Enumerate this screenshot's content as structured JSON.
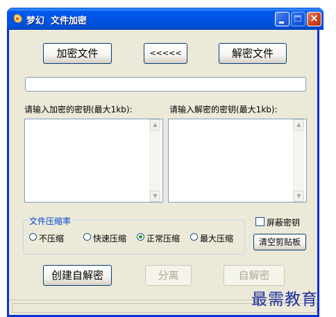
{
  "window": {
    "title": "梦幻  文件加密"
  },
  "toolbar": {
    "encrypt_label": "加密文件",
    "swap_label": "<<<<<",
    "decrypt_label": "解密文件"
  },
  "keys": {
    "encrypt_label": "请输入加密的密钥(最大1kb):",
    "decrypt_label": "请输入解密的密钥(最大1kb):",
    "encrypt_value": "",
    "decrypt_value": ""
  },
  "compression": {
    "legend": "文件压缩率",
    "options": [
      "不压缩",
      "快速压缩",
      "正常压缩",
      "最大压缩"
    ],
    "selected": "正常压缩"
  },
  "options": {
    "mask_key_label": "屏蔽密钥",
    "mask_key_checked": false,
    "clear_clipboard_label": "清空剪贴板"
  },
  "actions": {
    "create_sfx_label": "创建自解密",
    "separate_label": "分离",
    "self_decrypt_label": "自解密"
  },
  "watermark": "最需教育"
}
